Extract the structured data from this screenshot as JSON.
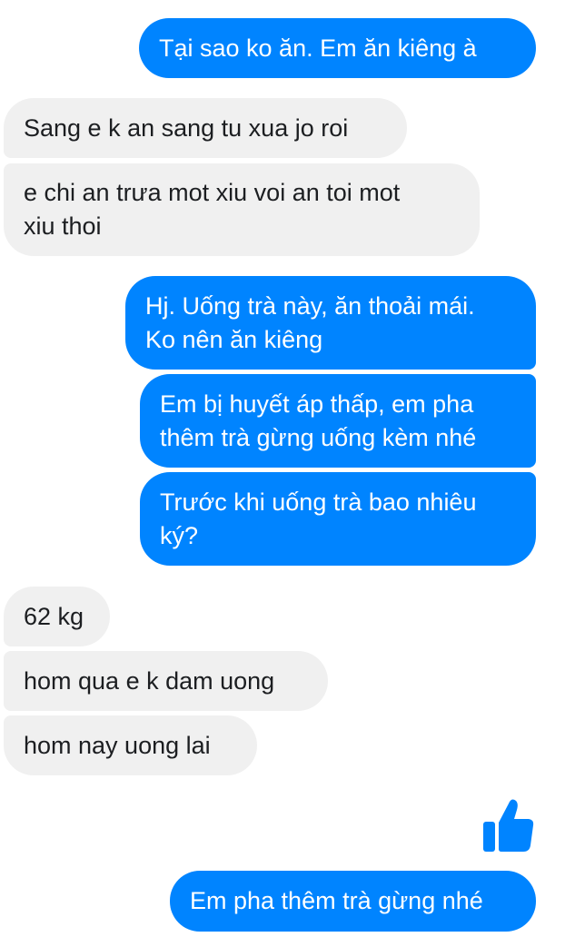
{
  "conversation": {
    "messages": [
      {
        "sender": "me",
        "text": "Tại sao ko ăn. Em ăn kiêng à"
      },
      {
        "sender": "them",
        "text": "Sang e k an sang tu xua jo roi"
      },
      {
        "sender": "them",
        "text": "e chi an trưa mot xiu voi an toi mot\nxiu thoi"
      },
      {
        "sender": "me",
        "text": "Hj. Uống trà này, ăn thoải mái.\nKo nên ăn kiêng"
      },
      {
        "sender": "me",
        "text": "Em bị huyết áp thấp, em pha\nthêm trà gừng uống kèm nhé"
      },
      {
        "sender": "me",
        "text": "Trước khi uống trà bao nhiêu\nký?"
      },
      {
        "sender": "them",
        "text": "62 kg"
      },
      {
        "sender": "them",
        "text": "hom qua e k dam uong"
      },
      {
        "sender": "them",
        "text": "hom nay uong lai"
      },
      {
        "sender": "me",
        "type": "like",
        "icon": "thumbs-up-icon"
      },
      {
        "sender": "me",
        "text": "Em pha thêm trà gừng nhé"
      }
    ]
  },
  "colors": {
    "outgoing_bubble": "#0084ff",
    "incoming_bubble": "#f0f0f0",
    "outgoing_text": "#ffffff",
    "incoming_text": "#1c1e21"
  }
}
